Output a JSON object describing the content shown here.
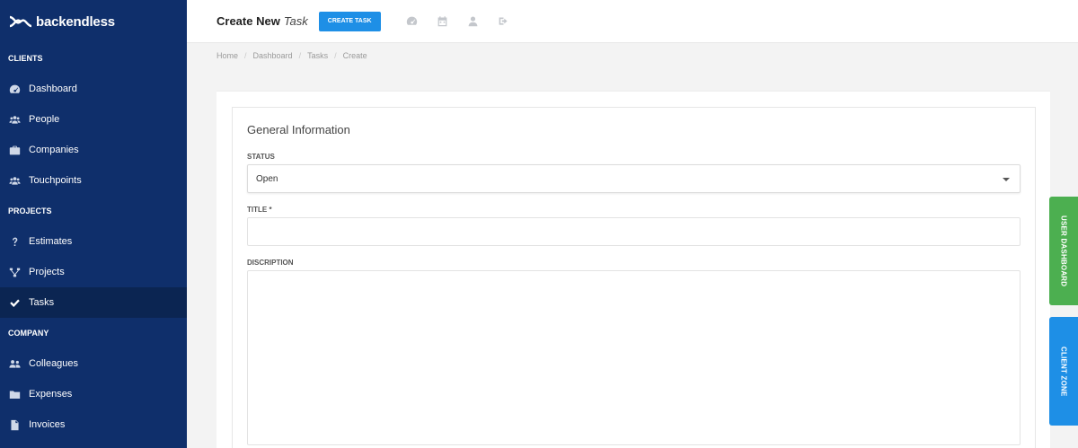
{
  "app": {
    "logo_text": "backendless"
  },
  "sidebar": {
    "sections": [
      {
        "title": "CLIENTS"
      },
      {
        "title": "PROJECTS"
      },
      {
        "title": "COMPANY"
      }
    ],
    "items": [
      {
        "label": "Dashboard",
        "icon": "dashboard-icon"
      },
      {
        "label": "People",
        "icon": "people-icon"
      },
      {
        "label": "Companies",
        "icon": "briefcase-icon"
      },
      {
        "label": "Touchpoints",
        "icon": "people-icon"
      },
      {
        "label": "Estimates",
        "icon": "question-icon"
      },
      {
        "label": "Projects",
        "icon": "sitemap-icon"
      },
      {
        "label": "Tasks",
        "icon": "check-icon",
        "active": true
      },
      {
        "label": "Colleagues",
        "icon": "people-icon"
      },
      {
        "label": "Expenses",
        "icon": "folder-icon"
      },
      {
        "label": "Invoices",
        "icon": "file-icon"
      }
    ]
  },
  "header": {
    "title": "Create New",
    "title_em": "Task",
    "create_button": "CREATE TASK",
    "icons": [
      "dashboard-icon",
      "calendar-icon",
      "user-icon",
      "sign-out-icon"
    ]
  },
  "breadcrumb": [
    "Home",
    "Dashboard",
    "Tasks",
    "Create"
  ],
  "form": {
    "section_title": "General Information",
    "status_label": "STATUS",
    "status_value": "Open",
    "title_label": "TITLE *",
    "title_value": "",
    "description_label": "DISCRIPTION",
    "description_value": ""
  },
  "side_tabs": {
    "user_dashboard": "USER DASHBOARD",
    "client_zone": "CLIENT ZONE"
  },
  "colors": {
    "sidebar_bg": "#0f2f6b",
    "accent_blue": "#1e8fe6",
    "accent_green": "#4caf50"
  }
}
